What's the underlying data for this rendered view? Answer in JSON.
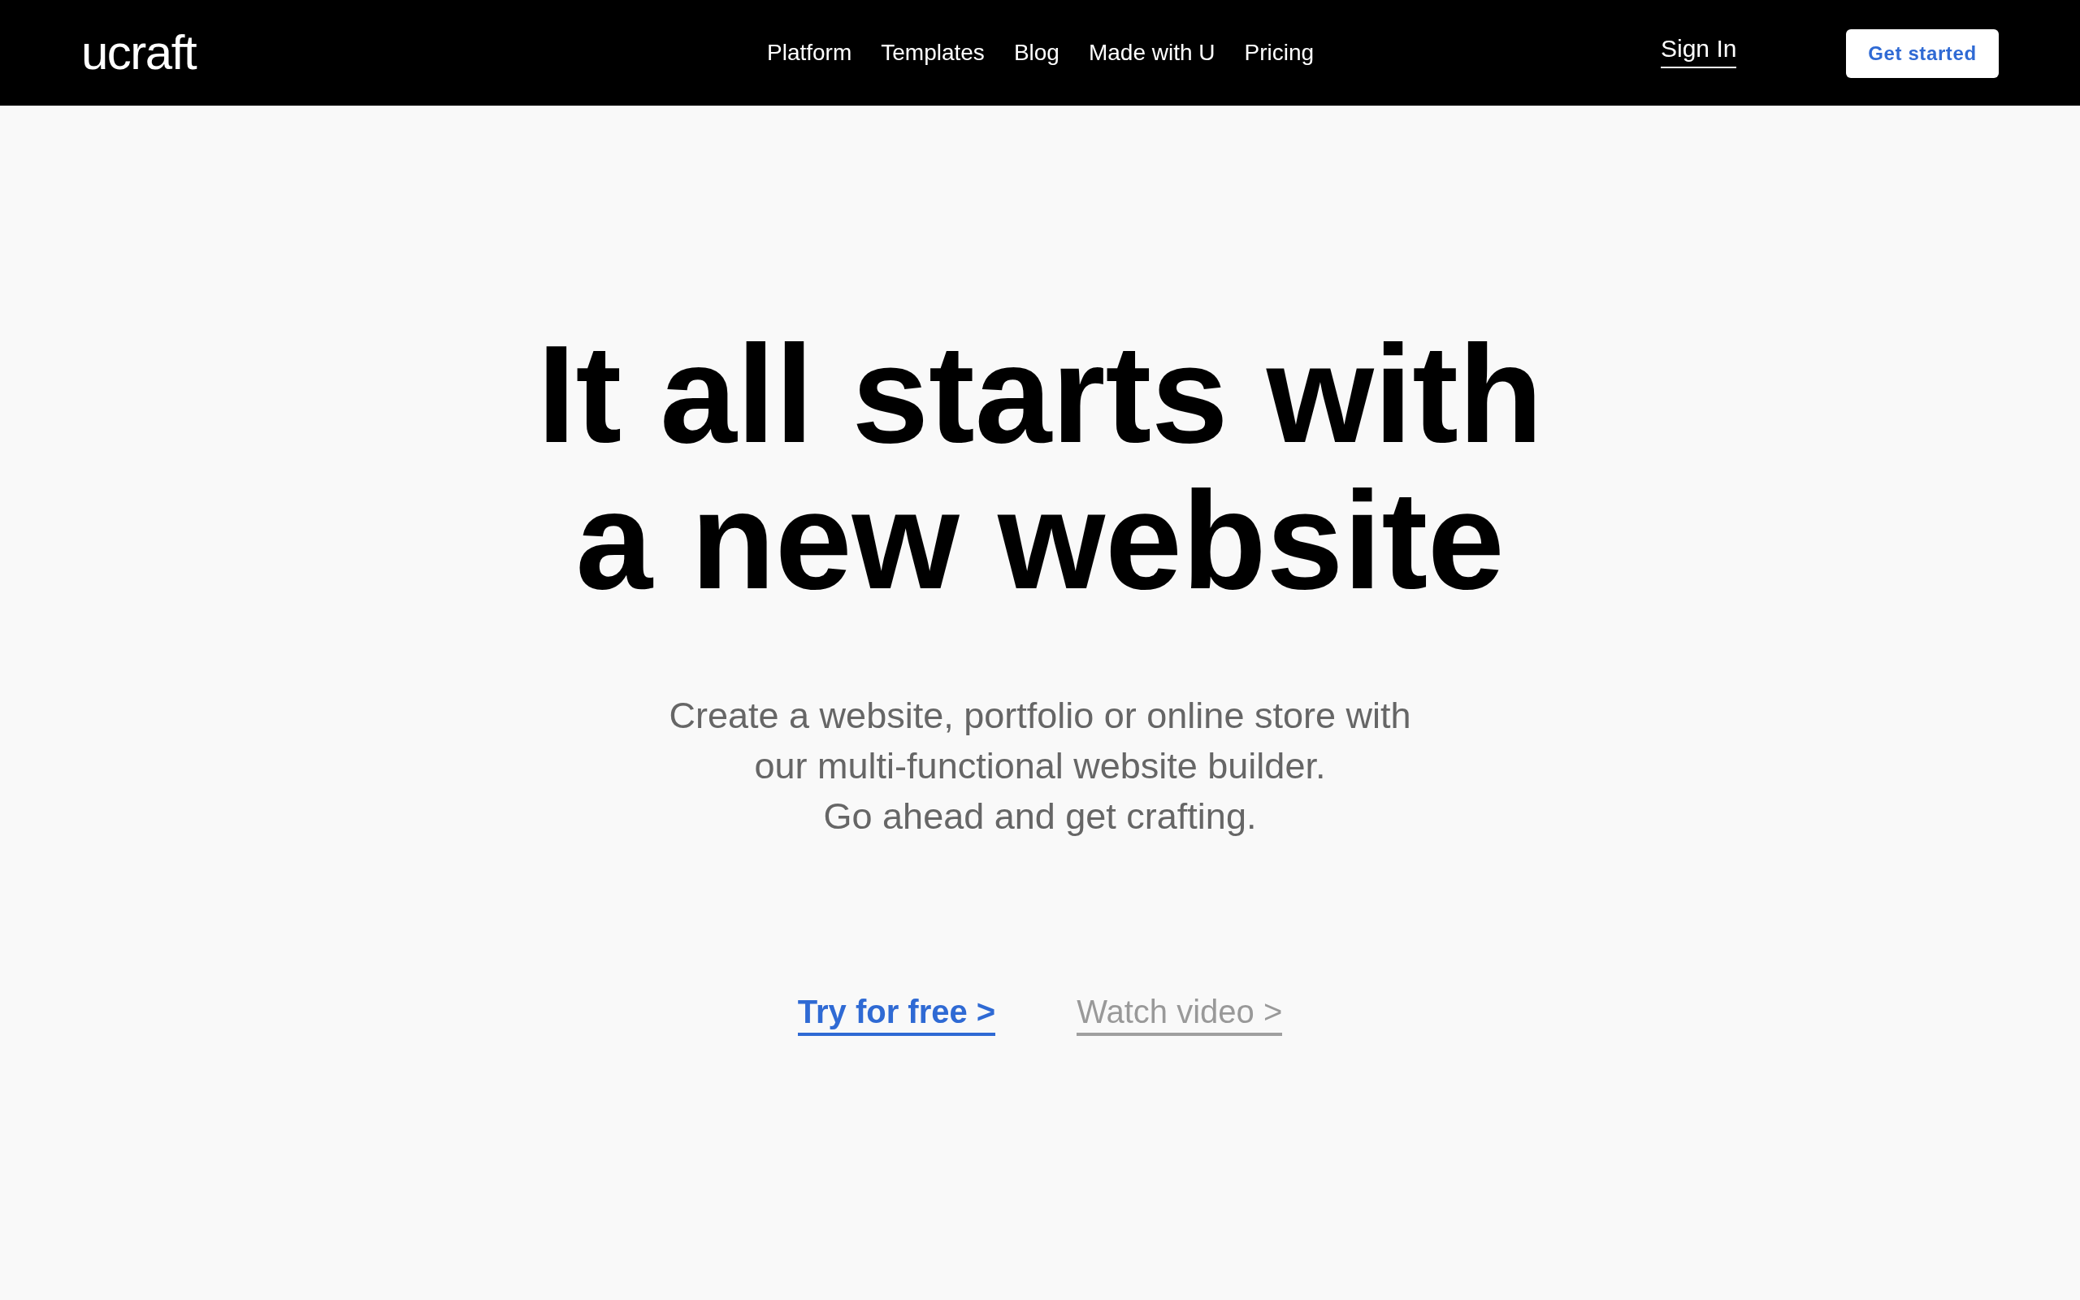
{
  "header": {
    "logo": "ucraft",
    "nav": [
      "Platform",
      "Templates",
      "Blog",
      "Made with U",
      "Pricing"
    ],
    "sign_in": "Sign In",
    "cta": "Get started"
  },
  "hero": {
    "title_lines": [
      "It all starts with",
      "a new website"
    ],
    "subtitle_lines": [
      "Create a website, portfolio or online store with",
      "our multi-functional website builder.",
      "Go ahead and get crafting."
    ],
    "actions": [
      {
        "kind": "primary",
        "label": "Try for free >"
      },
      {
        "kind": "secondary",
        "label": "Watch video >"
      }
    ]
  }
}
